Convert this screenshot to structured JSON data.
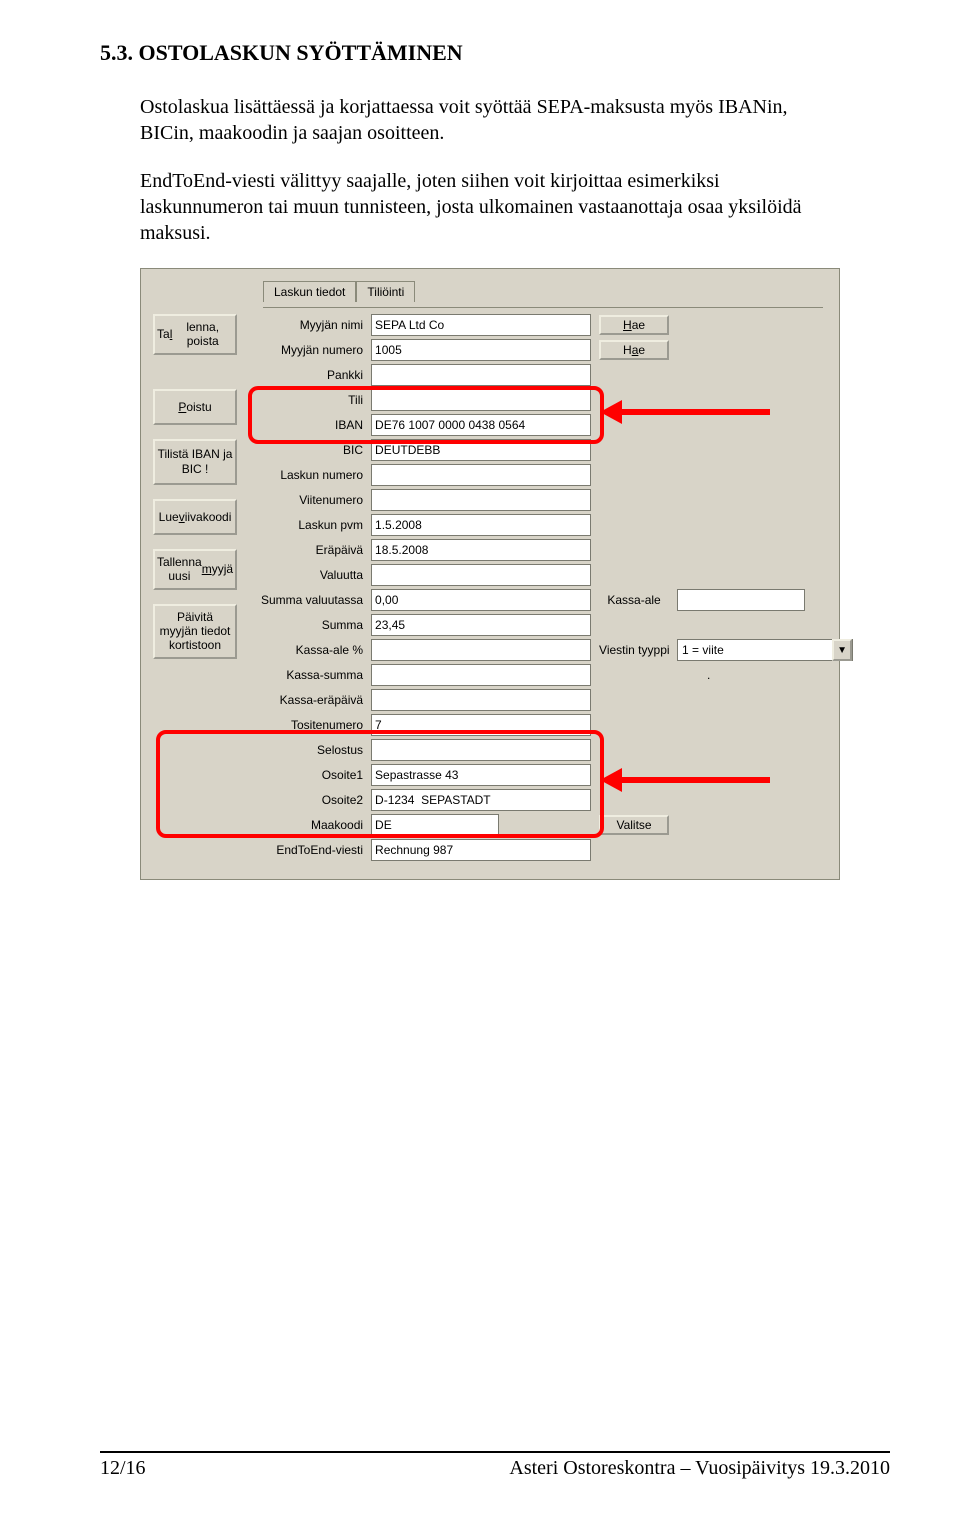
{
  "heading": "5.3. OSTOLASKUN SYÖTTÄMINEN",
  "para1": "Ostolaskua lisättäessä ja korjattaessa voit syöttää SEPA-maksusta myös IBANin, BICin, maakoodin ja saajan osoitteen.",
  "para2": "EndToEnd-viesti välittyy saajalle, joten siihen voit kirjoittaa esimerkiksi laskunnumeron tai muun tunnisteen, josta ulkomainen vastaanottaja osaa yksilöidä maksusi.",
  "tabs": {
    "t1": "Laskun tiedot",
    "t2": "Tiliöinti"
  },
  "leftButtons": {
    "b1": "Tallenna, poista",
    "b2": "Poistu",
    "b3": "Tilistä IBAN ja BIC !",
    "b4": "Lue viivakoodi",
    "b5": "Tallenna uusi myyjä",
    "b6": "Päivitä myyjän tiedot kortistoon"
  },
  "labels": {
    "myyja_nimi": "Myyjän nimi",
    "myyja_numero": "Myyjän numero",
    "pankki": "Pankki",
    "tili": "Tili",
    "iban": "IBAN",
    "bic": "BIC",
    "laskun_numero": "Laskun numero",
    "viitenumero": "Viitenumero",
    "laskun_pvm": "Laskun pvm",
    "erapaiva": "Eräpäivä",
    "valuutta": "Valuutta",
    "summa_valuutassa": "Summa valuutassa",
    "summa": "Summa",
    "kassa_ale_pct": "Kassa-ale %",
    "kassa_summa": "Kassa-summa",
    "kassa_erapaiva": "Kassa-eräpäivä",
    "tositenumero": "Tositenumero",
    "selostus": "Selostus",
    "osoite1": "Osoite1",
    "osoite2": "Osoite2",
    "maakoodi": "Maakoodi",
    "endtoend": "EndToEnd-viesti",
    "kassa_ale": "Kassa-ale",
    "viestin_tyyppi": "Viestin tyyppi"
  },
  "buttons": {
    "hae": "Hae",
    "valitse": "Valitse"
  },
  "values": {
    "myyja_nimi": "SEPA Ltd Co",
    "myyja_numero": "1005",
    "pankki": "",
    "tili": "",
    "iban": "DE76 1007 0000 0438 0564",
    "bic": "DEUTDEBB",
    "laskun_numero": "",
    "viitenumero": "",
    "laskun_pvm": "1.5.2008",
    "erapaiva": "18.5.2008",
    "valuutta": "",
    "summa_valuutassa": "0,00",
    "summa": "23,45",
    "kassa_ale_pct": "",
    "kassa_summa": "",
    "kassa_erapaiva": "",
    "tositenumero": "7",
    "selostus": "",
    "osoite1": "Sepastrasse 43",
    "osoite2": "D-1234  SEPASTADT",
    "maakoodi": "DE",
    "endtoend": "Rechnung 987",
    "kassa_ale": "",
    "viestin_tyyppi": "1 = viite"
  },
  "footer": {
    "left": "12/16",
    "right": "Asteri Ostoreskontra – Vuosipäivitys 19.3.2010"
  }
}
